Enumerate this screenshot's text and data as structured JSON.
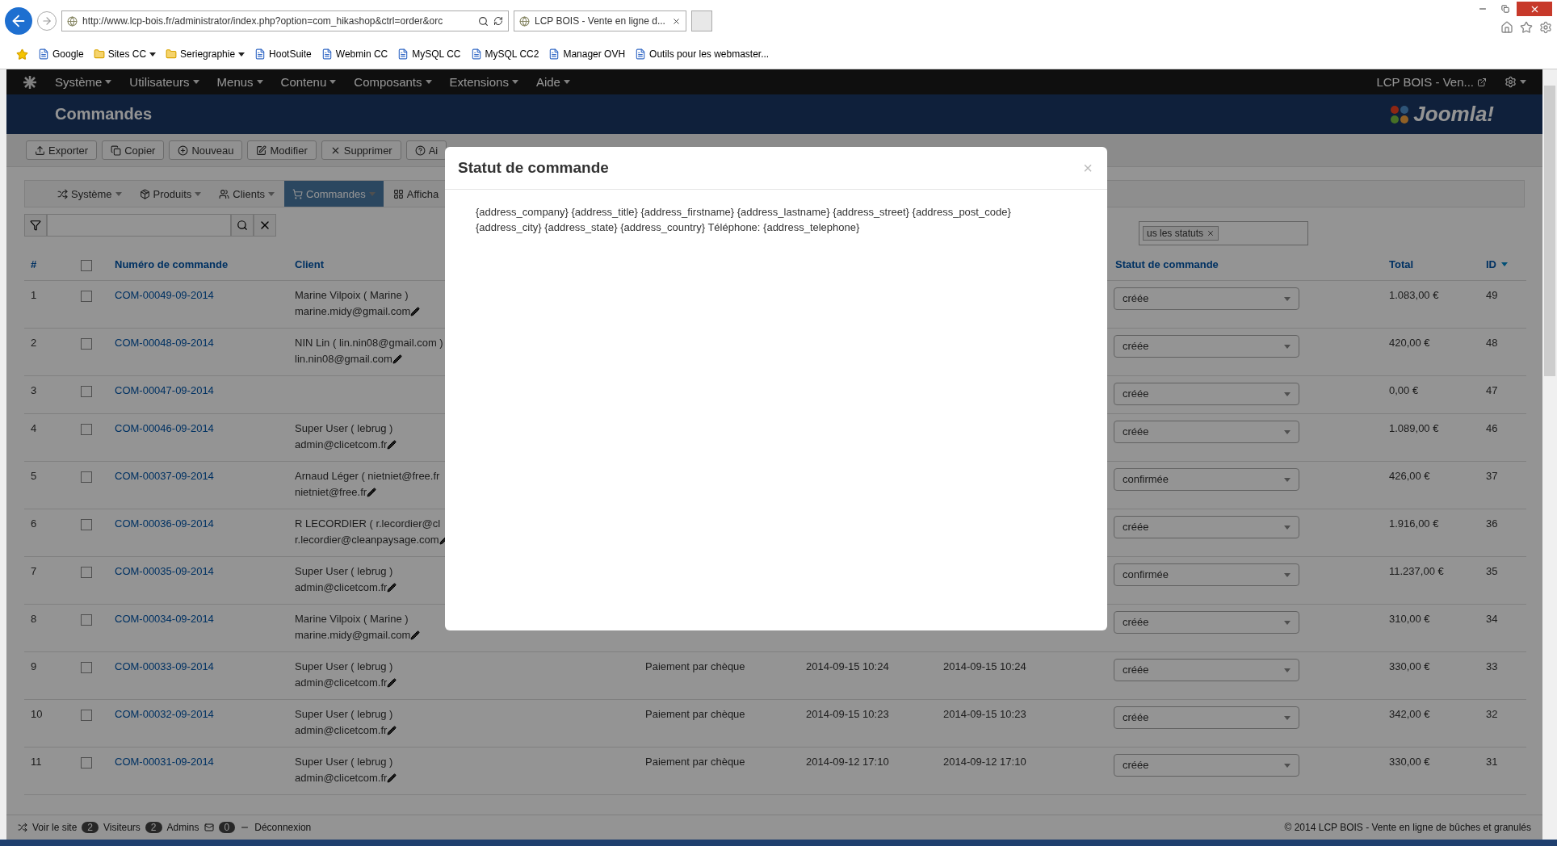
{
  "browser": {
    "address": "http://www.lcp-bois.fr/administrator/index.php?option=com_hikashop&ctrl=order&orc",
    "tab_title": "LCP BOIS - Vente en ligne d...",
    "bookmarks": [
      {
        "label": "Google",
        "kind": "page"
      },
      {
        "label": "Sites CC",
        "kind": "folder"
      },
      {
        "label": "Seriegraphie",
        "kind": "folder"
      },
      {
        "label": "HootSuite",
        "kind": "page"
      },
      {
        "label": "Webmin CC",
        "kind": "page"
      },
      {
        "label": "MySQL CC",
        "kind": "page"
      },
      {
        "label": "MySQL CC2",
        "kind": "page"
      },
      {
        "label": "Manager OVH",
        "kind": "page"
      },
      {
        "label": "Outils pour les webmaster...",
        "kind": "page"
      }
    ]
  },
  "admin_nav": {
    "items": [
      "Système",
      "Utilisateurs",
      "Menus",
      "Contenu",
      "Composants",
      "Extensions",
      "Aide"
    ],
    "site_link": "LCP BOIS - Ven..."
  },
  "header": {
    "title": "Commandes",
    "logo": "Joomla!"
  },
  "toolbar": [
    {
      "label": "Exporter",
      "kind": "export"
    },
    {
      "label": "Copier",
      "kind": "copy"
    },
    {
      "label": "Nouveau",
      "kind": "new"
    },
    {
      "label": "Modifier",
      "kind": "edit"
    },
    {
      "label": "Supprimer",
      "kind": "delete"
    },
    {
      "label": "Ai",
      "kind": "help"
    }
  ],
  "submenu": [
    {
      "label": "Système",
      "selected": false
    },
    {
      "label": "Produits",
      "selected": false
    },
    {
      "label": "Clients",
      "selected": false
    },
    {
      "label": "Commandes",
      "selected": true
    },
    {
      "label": "Afficha",
      "selected": false
    }
  ],
  "status_filter": {
    "tag": "us les statuts"
  },
  "table": {
    "select_all_checked": false,
    "columns": [
      {
        "label": "#",
        "sorted": false
      },
      {
        "label": "Numéro de commande",
        "sorted": false
      },
      {
        "label": "Client",
        "sorted": false
      },
      {
        "label": "Statut de commande",
        "sorted": false
      },
      {
        "label": "Total",
        "sorted": false
      },
      {
        "label": "ID",
        "sorted": true
      }
    ],
    "rows": [
      {
        "num": "1",
        "checked": false,
        "order": "COM-00049-09-2014",
        "client_name": "Marine Vilpoix ( Marine )",
        "client_email": "marine.midy@gmail.com",
        "status": "créée",
        "total": "1.083,00 €",
        "id": "49"
      },
      {
        "num": "2",
        "checked": false,
        "order": "COM-00048-09-2014",
        "client_name": "NIN Lin ( lin.nin08@gmail.com )",
        "client_email": "lin.nin08@gmail.com",
        "status": "créée",
        "total": "420,00 €",
        "id": "48"
      },
      {
        "num": "3",
        "checked": false,
        "order": "COM-00047-09-2014",
        "status": "créée",
        "total": "0,00 €",
        "id": "47"
      },
      {
        "num": "4",
        "checked": false,
        "order": "COM-00046-09-2014",
        "client_name": "Super User ( lebrug )",
        "client_email": "admin@clicetcom.fr",
        "status": "créée",
        "total": "1.089,00 €",
        "id": "46"
      },
      {
        "num": "5",
        "checked": false,
        "order": "COM-00037-09-2014",
        "client_name": "Arnaud Léger ( nietniet@free.fr",
        "client_email": "nietniet@free.fr",
        "status": "confirmée",
        "total": "426,00 €",
        "id": "37"
      },
      {
        "num": "6",
        "checked": false,
        "order": "COM-00036-09-2014",
        "client_name": "R LECORDIER ( r.lecordier@cl",
        "client_email": "r.lecordier@cleanpaysage.com",
        "status": "créée",
        "total": "1.916,00 €",
        "id": "36"
      },
      {
        "num": "7",
        "checked": false,
        "order": "COM-00035-09-2014",
        "client_name": "Super User ( lebrug )",
        "client_email": "admin@clicetcom.fr",
        "status": "confirmée",
        "total": "11.237,00 €",
        "id": "35"
      },
      {
        "num": "8",
        "checked": false,
        "order": "COM-00034-09-2014",
        "client_name": "Marine Vilpoix ( Marine )",
        "client_email": "marine.midy@gmail.com",
        "status": "créée",
        "total": "310,00 €",
        "id": "34"
      },
      {
        "num": "9",
        "checked": false,
        "order": "COM-00033-09-2014",
        "client_name": "Super User ( lebrug )",
        "client_email": "admin@clicetcom.fr",
        "payment": "Paiement par chèque",
        "created": "2014-09-15 10:24",
        "modified": "2014-09-15 10:24",
        "status": "créée",
        "total": "330,00 €",
        "id": "33"
      },
      {
        "num": "10",
        "checked": false,
        "order": "COM-00032-09-2014",
        "client_name": "Super User ( lebrug )",
        "client_email": "admin@clicetcom.fr",
        "payment": "Paiement par chèque",
        "created": "2014-09-15 10:23",
        "modified": "2014-09-15 10:23",
        "status": "créée",
        "total": "342,00 €",
        "id": "32"
      },
      {
        "num": "11",
        "checked": false,
        "order": "COM-00031-09-2014",
        "client_name": "Super User ( lebrug )",
        "client_email": "admin@clicetcom.fr",
        "payment": "Paiement par chèque",
        "created": "2014-09-12 17:10",
        "modified": "2014-09-12 17:10",
        "status": "créée",
        "total": "330,00 €",
        "id": "31"
      }
    ]
  },
  "footer": {
    "view_site": "Voir le site",
    "visitors_count": "2",
    "visitors": "Visiteurs",
    "admins_count": "2",
    "admins": "Admins",
    "messages_count": "0",
    "logout": "Déconnexion",
    "copyright": "© 2014 LCP BOIS - Vente en ligne de bûches et granulés"
  },
  "modal": {
    "title": "Statut de commande",
    "close": "×",
    "body": "{address_company} {address_title} {address_firstname} {address_lastname} {address_street} {address_post_code} {address_city} {address_state} {address_country} Téléphone: {address_telephone}"
  }
}
